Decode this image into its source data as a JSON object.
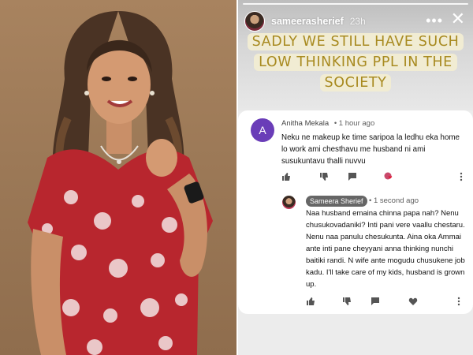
{
  "story": {
    "username": "sameerasherief",
    "time": "23h",
    "more_label": "•••",
    "close_label": "✕",
    "caption_lines": [
      "SADLY WE STILL HAVE SUCH",
      "LOW THINKING PPL IN THE",
      "SOCIETY"
    ]
  },
  "comment": {
    "avatar_letter": "A",
    "author": "Anitha Mekala",
    "when": "• 1 hour ago",
    "text": "Neku ne makeup ke time saripoa la ledhu eka home lo work ami chesthavu me husband ni ami susukuntavu thalli nuvvu"
  },
  "reply": {
    "author": "Sameera Sherief",
    "when": "• 1 second ago",
    "text": "Naa husband emaina chinna papa nah? Nenu chusukovadaniki? Inti pani vere vaallu chestaru. Nenu naa panulu chesukunta. Aina oka Ammai ante inti pane cheyyani anna thinking nunchi baitiki randi. N wife ante mogudu chusukene job kadu. I'll take care of my kids, husband is grown up."
  },
  "icons": {
    "like": "thumbs-up-icon",
    "dislike": "thumbs-down-icon",
    "reply": "reply-icon",
    "heart": "heart-icon",
    "more": "more-vertical-icon"
  },
  "colors": {
    "caption_text": "#a88a20",
    "caption_highlight": "#f1ecd3",
    "commenter_avatar": "#6a3db8",
    "creator_badge": "#666666"
  }
}
